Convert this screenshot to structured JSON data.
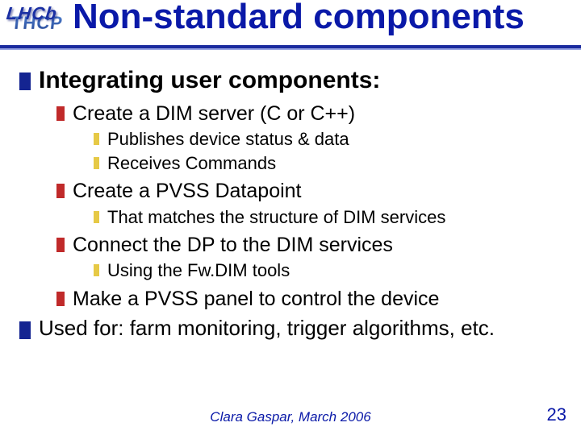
{
  "logo": {
    "back": "THCP",
    "front": "LHCb"
  },
  "title": "Non-standard components",
  "bullets": {
    "l1a": "Integrating user components:",
    "l2a": "Create a DIM server (C or C++)",
    "l3a1": "Publishes device status & data",
    "l3a2": "Receives Commands",
    "l2b": " Create a PVSS Datapoint",
    "l3b1": "That matches the structure of DIM services",
    "l2c": "Connect the DP to the DIM services",
    "l3c1": "Using the Fw.DIM tools",
    "l2d": "Make a PVSS panel to control the device",
    "l1b": "Used for: farm monitoring, trigger algorithms, etc."
  },
  "footer": {
    "author": "Clara Gaspar, March 2006",
    "page": "23"
  }
}
